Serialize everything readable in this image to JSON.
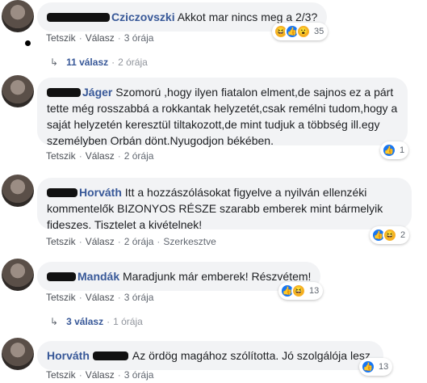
{
  "actions": {
    "like": "Tetszik",
    "reply": "Válasz",
    "edit": "Szerkesztve",
    "sep": "·"
  },
  "comments": [
    {
      "author": "Cziczovszki",
      "text": "Akkot mar nincs meg a 2/3?",
      "time": "3 órája",
      "reactions": [
        "haha",
        "like",
        "wow"
      ],
      "reaction_count": "35",
      "replies": {
        "count": "11 válasz",
        "time": "2 órája"
      }
    },
    {
      "author": "Jáger",
      "text": "Szomorú ,hogy ilyen fiatalon elment,de sajnos ez a párt tette még rosszabbá a rokkantak helyzetét,csak remélni tudom,hogy a saját helyzetén keresztül tiltakozott,de mint tudjuk a többség ill.egy személyben Orbán dönt.Nyugodjon békében.",
      "time": "2 órája",
      "reactions": [
        "like"
      ],
      "reaction_count": "1"
    },
    {
      "author": "Horváth",
      "text": "Itt a hozzászólásokat figyelve a nyilván ellenzéki kommentelők BIZONYOS RÉSZE szarabb emberek mint bármelyik fideszes. Tisztelet a kivételnek!",
      "time": "2 órája",
      "edited": true,
      "reactions": [
        "like",
        "haha"
      ],
      "reaction_count": "2"
    },
    {
      "author": "Mandák",
      "text": "Maradjunk már emberek! Részvétem!",
      "time": "3 órája",
      "reactions": [
        "like",
        "haha"
      ],
      "reaction_count": "13",
      "replies": {
        "count": "3 válasz",
        "time": "1 órája"
      }
    },
    {
      "author": "Horváth",
      "text": "Az ördög magához szólította. Jó szolgálója lesz.",
      "time": "3 órája",
      "reactions": [
        "like"
      ],
      "reaction_count": "13"
    }
  ]
}
